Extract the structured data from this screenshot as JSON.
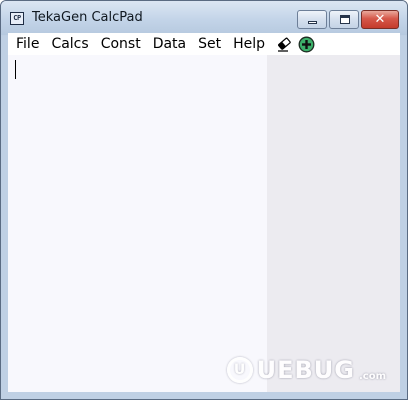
{
  "window": {
    "title": "TekaGen CalcPad",
    "app_icon_text": "CP"
  },
  "menu": {
    "items": [
      "File",
      "Calcs",
      "Const",
      "Data",
      "Set",
      "Help"
    ]
  },
  "toolbar_icons": [
    "eraser-icon",
    "add-circle-icon"
  ],
  "watermark": {
    "brand": "UEBUG",
    "suffix": ".com"
  },
  "colors": {
    "editor_background": "#f8f8fd",
    "results_background": "#ecebf0",
    "add_icon_fill": "#3cb06a",
    "close_button": "#c43b2c"
  }
}
